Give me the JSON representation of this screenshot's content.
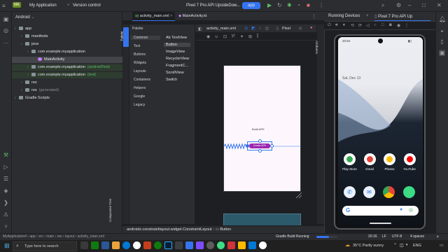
{
  "titlebar": {
    "project_name": "My Application",
    "vcs": "Version control",
    "device": "Pixel 7 Pro API UpsideDow...",
    "run_config": "app"
  },
  "project_panel": {
    "view": "Android",
    "tree": [
      {
        "label": "app",
        "indent": 0
      },
      {
        "label": "manifests",
        "indent": 1
      },
      {
        "label": "java",
        "indent": 1
      },
      {
        "label": "com.example.myapplication",
        "indent": 2
      },
      {
        "label": "MainActivity",
        "indent": 3
      },
      {
        "label": "com.example.myapplication",
        "suffix": "(androidTest)",
        "indent": 2
      },
      {
        "label": "com.example.myapplication",
        "suffix": "(test)",
        "indent": 2
      },
      {
        "label": "res",
        "indent": 1
      },
      {
        "label": "res",
        "suffix": "(generated)",
        "indent": 1
      },
      {
        "label": "Gradle Scripts",
        "indent": 0
      }
    ]
  },
  "editor": {
    "tabs": [
      "activity_main.xml",
      "MainActivity.kt"
    ],
    "palette_title": "Palette",
    "palette_side_label": "Palette",
    "component_tree_label": "Component Tree",
    "attributes_label": "Attributes",
    "categories": [
      "Common",
      "Text",
      "Buttons",
      "Widgets",
      "Layouts",
      "Containers",
      "Helpers",
      "Google",
      "Legacy"
    ],
    "items": [
      "Ab TextView",
      "Button",
      "ImageView",
      "RecyclerView",
      "FragmentC...",
      "ScrollView",
      "Switch"
    ],
    "design_file": "activity_main.xml",
    "design_device": "Pixel",
    "preview_text": "Build APK",
    "preview_button": "Create APK",
    "breadcrumb": [
      "androidx.constraintlayout.widget.ConstraintLayout",
      "Button"
    ]
  },
  "running": {
    "tab1": "Running Devices",
    "tab2": "Pixel 7 Pro API Up",
    "time": "20:54",
    "date": "Sat, Dec 13",
    "apps_row1": [
      "Play Store",
      "Gmail",
      "Photos",
      "YouTube"
    ],
    "search_glyph": "G"
  },
  "statusbar": {
    "path": [
      "MyApplication4",
      "app",
      "src",
      "main",
      "res",
      "layout",
      "activity_main.xml"
    ],
    "task": "Gradle Build Running",
    "pos": "20:16",
    "lf": "LF",
    "enc": "UTF-8",
    "indent": "4 spaces"
  },
  "taskbar": {
    "search": "Type here to search",
    "weather": "35°C  Partly sunny",
    "lang": "ENG"
  },
  "colors": {
    "accent": "#3574f0",
    "widget": "#9c27b0"
  }
}
